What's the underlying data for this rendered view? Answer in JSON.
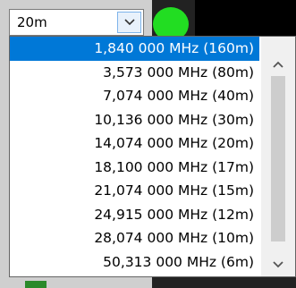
{
  "band_selector": {
    "selected": "20m",
    "items": [
      "1,840 000 MHz (160m)",
      "3,573 000 MHz (80m)",
      "7,074 000 MHz (40m)",
      "10,136 000 MHz (30m)",
      "14,074 000 MHz (20m)",
      "18,100 000 MHz (17m)",
      "21,074 000 MHz (15m)",
      "24,915 000 MHz (12m)",
      "28,074 000 MHz (10m)",
      "50,313 000 MHz (6m)"
    ],
    "highlighted_index": 0
  },
  "status_indicator": {
    "color": "#22dd22"
  },
  "colors": {
    "highlight": "#0078d7",
    "accent_text": "#ffd800"
  },
  "icons": [
    "chevron-down-icon",
    "scroll-up-icon",
    "scroll-down-icon"
  ]
}
